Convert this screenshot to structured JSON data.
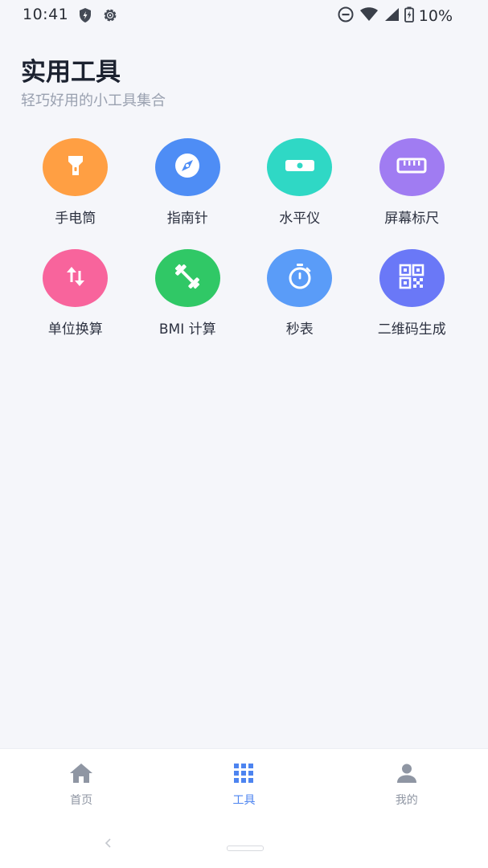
{
  "status_bar": {
    "time": "10:41",
    "battery": "10%",
    "icons": [
      "shield-icon",
      "gear-icon",
      "dnd-icon",
      "wifi-icon",
      "signal-icon",
      "battery-icon"
    ]
  },
  "header": {
    "title": "实用工具",
    "subtitle": "轻巧好用的小工具集合"
  },
  "tools": [
    {
      "label": "手电筒",
      "icon": "flashlight-icon",
      "color": "#ff9f43"
    },
    {
      "label": "指南针",
      "icon": "compass-icon",
      "color": "#4e8df5"
    },
    {
      "label": "水平仪",
      "icon": "level-icon",
      "color": "#2fd8c5"
    },
    {
      "label": "屏幕标尺",
      "icon": "ruler-icon",
      "color": "#a07cf2"
    },
    {
      "label": "单位换算",
      "icon": "swap-icon",
      "color": "#f8649c"
    },
    {
      "label": "BMI 计算",
      "icon": "dumbbell-icon",
      "color": "#30c866"
    },
    {
      "label": "秒表",
      "icon": "stopwatch-icon",
      "color": "#5a9cf8"
    },
    {
      "label": "二维码生成",
      "icon": "qrcode-icon",
      "color": "#6a78f7"
    }
  ],
  "bottom_nav": {
    "items": [
      {
        "label": "首页",
        "icon": "home-icon"
      },
      {
        "label": "工具",
        "icon": "grid-icon"
      },
      {
        "label": "我的",
        "icon": "person-icon"
      }
    ],
    "active_index": 1,
    "active_color": "#4d84f0",
    "inactive_color": "#8f96a3"
  }
}
